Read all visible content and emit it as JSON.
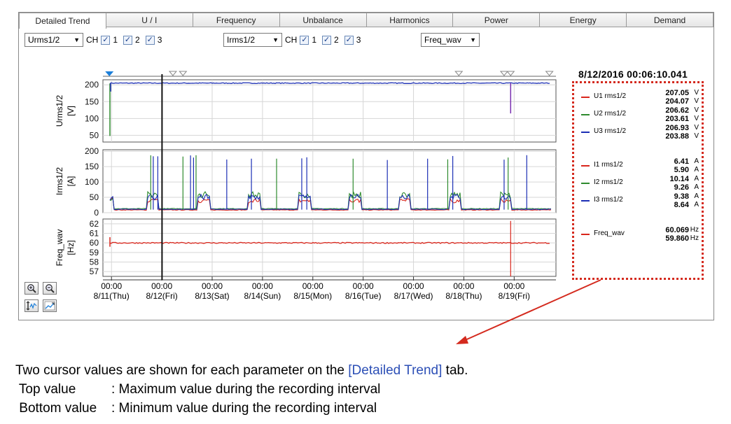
{
  "tabs": [
    "Detailed Trend",
    "U / I",
    "Frequency",
    "Unbalance",
    "Harmonics",
    "Power",
    "Energy",
    "Demand"
  ],
  "active_tab": "Detailed Trend",
  "controls": {
    "voltage_select": "Urms1/2",
    "current_select": "Irms1/2",
    "freq_select": "Freq_wav",
    "ch_label": "CH",
    "ch1": "1",
    "ch2": "2",
    "ch3": "3",
    "check_mark": "✓"
  },
  "cursor_time": "8/12/2016 00:06:10.041",
  "legend": [
    {
      "name": "U1 rms1/2",
      "color": "#d9261c",
      "max": "207.05",
      "min": "204.07",
      "unit": "V"
    },
    {
      "name": "U2 rms1/2",
      "color": "#2e8b2e",
      "max": "206.62",
      "min": "203.61",
      "unit": "V"
    },
    {
      "name": "U3 rms1/2",
      "color": "#1c2fb5",
      "max": "206.93",
      "min": "203.88",
      "unit": "V"
    },
    {
      "name": "I1 rms1/2",
      "color": "#d9261c",
      "max": "6.41",
      "min": "5.90",
      "unit": "A"
    },
    {
      "name": "I2 rms1/2",
      "color": "#2e8b2e",
      "max": "10.14",
      "min": "9.26",
      "unit": "A"
    },
    {
      "name": "I3 rms1/2",
      "color": "#1c2fb5",
      "max": "9.38",
      "min": "8.64",
      "unit": "A"
    },
    {
      "name": "Freq_wav",
      "color": "#d9261c",
      "max": "60.069",
      "min": "59.860",
      "unit": "Hz"
    }
  ],
  "chart_data": {
    "type": "line",
    "x_labels": [
      {
        "time": "00:00",
        "date": "8/11(Thu)"
      },
      {
        "time": "00:00",
        "date": "8/12(Fri)"
      },
      {
        "time": "00:00",
        "date": "8/13(Sat)"
      },
      {
        "time": "00:00",
        "date": "8/14(Sun)"
      },
      {
        "time": "00:00",
        "date": "8/15(Mon)"
      },
      {
        "time": "00:00",
        "date": "8/16(Tue)"
      },
      {
        "time": "00:00",
        "date": "8/17(Wed)"
      },
      {
        "time": "00:00",
        "date": "8/18(Thu)"
      },
      {
        "time": "00:00",
        "date": "8/19(Fri)"
      }
    ],
    "panels": [
      {
        "ylabel": "Urms1/2",
        "unit": "[V]",
        "ylim": [
          30,
          215
        ],
        "ticks": [
          "200",
          "150",
          "100",
          "50"
        ],
        "tick_values": [
          200,
          150,
          100,
          50
        ],
        "series": [
          {
            "name": "U3 rms1/2",
            "color": "#1c2fb5",
            "level": 205
          }
        ]
      },
      {
        "ylabel": "Irms1/2",
        "unit": "[A]",
        "ylim": [
          0,
          205
        ],
        "ticks": [
          "200",
          "150",
          "100",
          "50",
          "0"
        ],
        "tick_values": [
          200,
          150,
          100,
          50,
          0
        ],
        "series": [
          {
            "name": "I1 rms1/2",
            "color": "#d9261c"
          },
          {
            "name": "I2 rms1/2",
            "color": "#2e8b2e"
          },
          {
            "name": "I3 rms1/2",
            "color": "#1c2fb5"
          }
        ]
      },
      {
        "ylabel": "Freq_wav",
        "unit": "[Hz]",
        "ylim": [
          56.5,
          62.5
        ],
        "ticks": [
          "62",
          "61",
          "60",
          "59",
          "58",
          "57"
        ],
        "tick_values": [
          62,
          61,
          60,
          59,
          58,
          57
        ],
        "series": [
          {
            "name": "Freq_wav",
            "color": "#d9261c",
            "level": 60
          }
        ]
      }
    ],
    "cursor_day": 1.004,
    "event_markers_days": [
      1.22,
      1.42,
      6.9,
      7.8,
      7.93,
      8.7
    ],
    "grid": true
  },
  "caption": {
    "line1_pre": "Two cursor values are shown for each parameter on the ",
    "line1_hl": "[Detailed Trend]",
    "line1_post": " tab.",
    "line2_label": " Top value",
    "line2_sep": ": Maximum value during the recording interval",
    "line3_label": " Bottom value",
    "line3_sep": ": Minimum value during the recording interval"
  }
}
